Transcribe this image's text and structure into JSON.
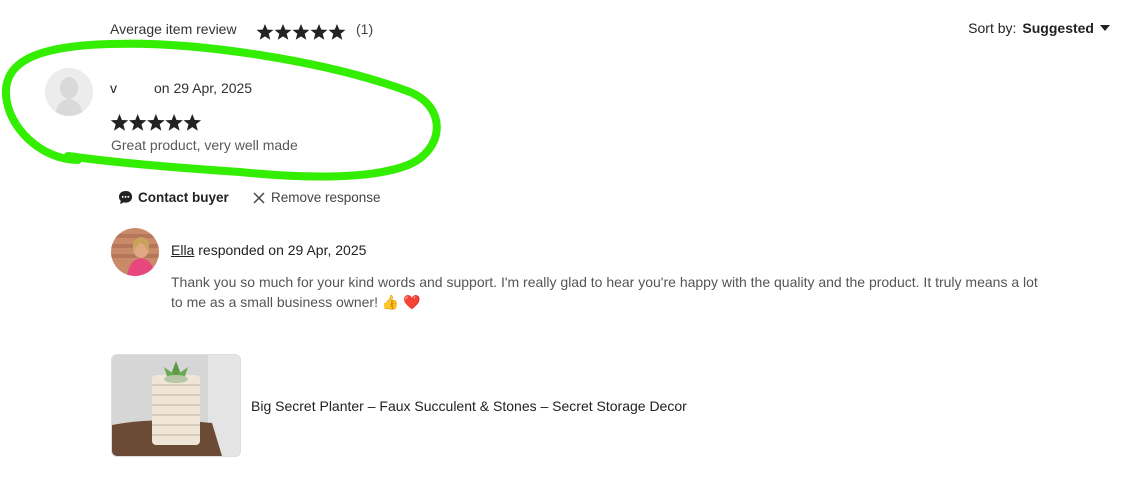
{
  "header": {
    "average_label": "Average item review",
    "average_rating": 5,
    "review_count": "(1)",
    "sort_label": "Sort by:",
    "sort_value": "Suggested"
  },
  "review": {
    "reviewer_name": "v",
    "date_text": "on 29 Apr, 2025",
    "rating": 5,
    "text": "Great product, very well made"
  },
  "actions": {
    "contact_buyer": "Contact buyer",
    "remove_response": "Remove response"
  },
  "response": {
    "seller_name": "Ella",
    "responded_text": " responded on 29 Apr, 2025",
    "text": "Thank you so much for your kind words and support. I'm really glad to hear you're happy with the quality and the product. It truly means a lot to me as a small business owner! 👍 ❤️"
  },
  "listing": {
    "title": "Big Secret Planter – Faux Succulent & Stones – Secret Storage Decor"
  },
  "colors": {
    "star": "#222222",
    "highlight": "#33ee00",
    "text": "#222222",
    "muted_text": "#595959"
  }
}
